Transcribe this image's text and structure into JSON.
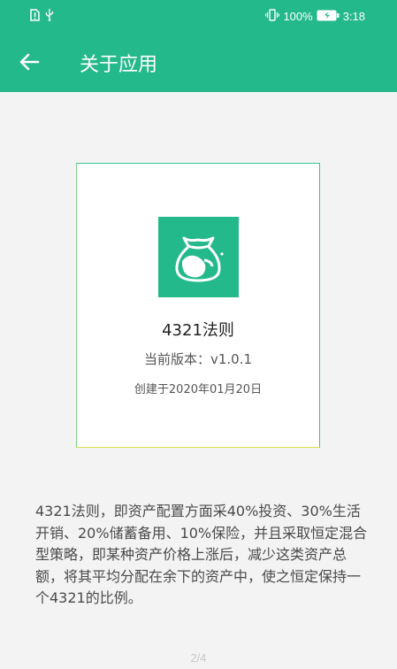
{
  "status_bar": {
    "time": "3:18",
    "battery": "100%",
    "icons": [
      "sim-alert-icon",
      "usb-icon",
      "vibrate-icon",
      "battery-charging-icon"
    ]
  },
  "header": {
    "title": "关于应用",
    "back_icon": "arrow-left-icon"
  },
  "card": {
    "app_icon": "money-bag-icon",
    "app_name": "4321法则",
    "version": "当前版本：v1.0.1",
    "created": "创建于2020年01月20日"
  },
  "description": "4321法则，即资产配置方面采40%投资、30%生活开销、20%储蓄备用、10%保险，并且采取恒定混合型策略，即某种资产价格上涨后，减少这类资产总额，将其平均分配在余下的资产中，使之恒定保持一个4321的比例。",
  "pager": "2/4",
  "colors": {
    "primary": "#24b98a",
    "background": "#f3f3f3",
    "card": "#ffffff",
    "text_dark": "#222222",
    "text_body": "#4a4a4a"
  }
}
